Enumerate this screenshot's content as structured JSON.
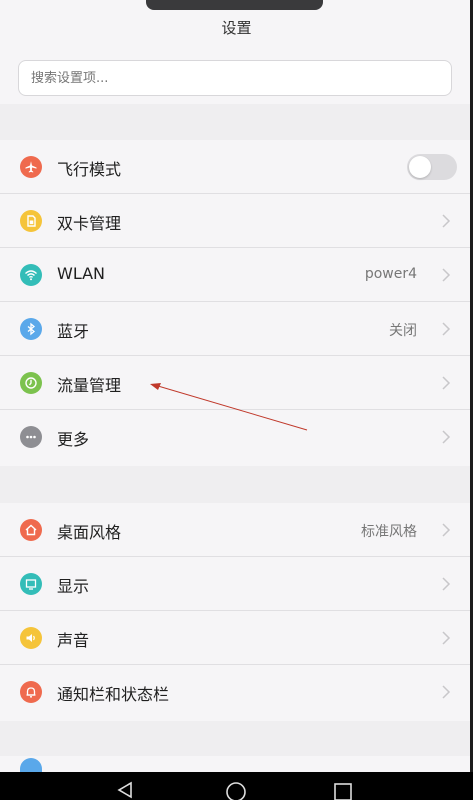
{
  "header": {
    "title": "设置"
  },
  "search": {
    "placeholder": "搜索设置项..."
  },
  "group1": [
    {
      "label": "飞行模式",
      "icon": "airplane-icon",
      "color": "#ef6a4e",
      "type": "toggle",
      "on": false
    },
    {
      "label": "双卡管理",
      "icon": "sim-card-icon",
      "color": "#f5c43a",
      "type": "chevron"
    },
    {
      "label": "WLAN",
      "icon": "wifi-icon",
      "color": "#33bdb8",
      "type": "chevron",
      "value": "power4"
    },
    {
      "label": "蓝牙",
      "icon": "bluetooth-icon",
      "color": "#5aa8ea",
      "type": "chevron",
      "value": "关闭"
    },
    {
      "label": "流量管理",
      "icon": "data-usage-icon",
      "color": "#7cc24e",
      "type": "chevron"
    },
    {
      "label": "更多",
      "icon": "more-icon",
      "color": "#8e8e93",
      "type": "chevron"
    }
  ],
  "group2": [
    {
      "label": "桌面风格",
      "icon": "home-icon",
      "color": "#ef6a4e",
      "type": "chevron",
      "value": "标准风格"
    },
    {
      "label": "显示",
      "icon": "display-icon",
      "color": "#33bdb8",
      "type": "chevron"
    },
    {
      "label": "声音",
      "icon": "sound-icon",
      "color": "#f5c43a",
      "type": "chevron"
    },
    {
      "label": "通知栏和状态栏",
      "icon": "notification-bell-icon",
      "color": "#ef6a4e",
      "type": "chevron"
    }
  ]
}
